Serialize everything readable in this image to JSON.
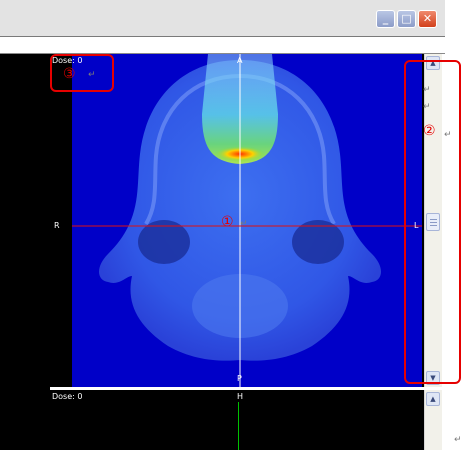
{
  "window": {
    "minimize_glyph": "_",
    "maximize_glyph": "□",
    "close_glyph": "✕"
  },
  "main_view": {
    "dose_label": "Dose: 0",
    "orient_top": "A",
    "orient_bottom": "P",
    "orient_left": "R",
    "orient_right": "L",
    "crosshair_color": "#e01010",
    "background_color": "#0000c8"
  },
  "bottom_view": {
    "dose_label": "Dose: 0",
    "orient_top": "H",
    "crosshair_color": "#00c000"
  },
  "annotations": {
    "marker_1": "①",
    "marker_2": "②",
    "marker_3": "③",
    "return_mark": "↵",
    "color": "#e60000"
  },
  "icons": [
    "minimize-icon",
    "maximize-icon",
    "close-icon",
    "scroll-up-icon",
    "scroll-down-icon"
  ]
}
